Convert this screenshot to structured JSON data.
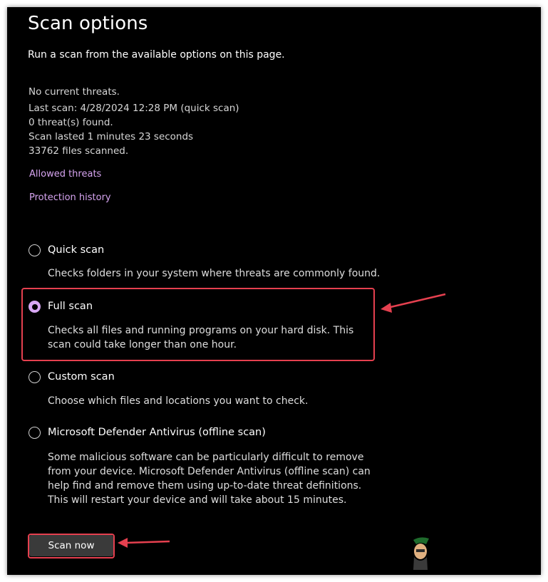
{
  "page": {
    "title": "Scan options",
    "subtitle": "Run a scan from the available options on this page."
  },
  "status": {
    "threats": "No current threats.",
    "last_scan": "Last scan: 4/28/2024 12:28 PM (quick scan)",
    "threats_found": "0 threat(s) found.",
    "duration": "Scan lasted 1 minutes 23 seconds",
    "files_scanned": "33762 files scanned."
  },
  "links": {
    "allowed_threats": "Allowed threats",
    "protection_history": "Protection history"
  },
  "options": [
    {
      "label": "Quick scan",
      "description": "Checks folders in your system where threats are commonly found.",
      "selected": false
    },
    {
      "label": "Full scan",
      "description": "Checks all files and running programs on your hard disk. This scan could take longer than one hour.",
      "selected": true
    },
    {
      "label": "Custom scan",
      "description": "Choose which files and locations you want to check.",
      "selected": false
    },
    {
      "label": "Microsoft Defender Antivirus (offline scan)",
      "description": "Some malicious software can be particularly difficult to remove from your device. Microsoft Defender Antivirus (offline scan) can help find and remove them using up-to-date threat definitions. This will restart your device and will take about 15 minutes.",
      "selected": false
    }
  ],
  "actions": {
    "scan_now": "Scan now"
  },
  "annotations": {
    "highlight_color": "#e5404f",
    "accent_color": "#d8a8f4"
  }
}
